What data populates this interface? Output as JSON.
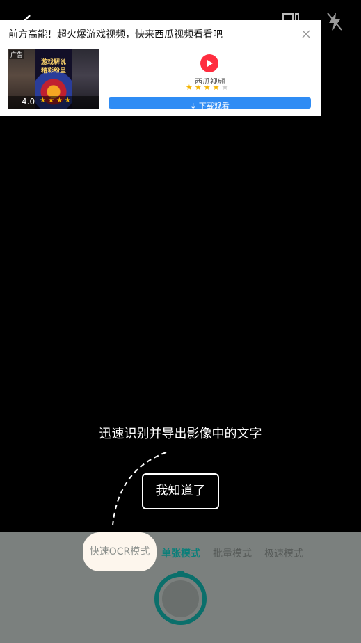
{
  "ad": {
    "title": "前方高能！超火爆游戏视频，快来西瓜视频看看吧",
    "tag": "广告",
    "rating": "4.0",
    "thumb_text": "游戏解说\n精彩纷呈",
    "app_name": "西瓜视频",
    "app_rating_stars": 4,
    "download_label": "下载观看",
    "brand_color": "#ff2d3f",
    "button_color": "#2f8cf4"
  },
  "guide": {
    "hint": "迅速识别并导出影像中的文字",
    "confirm_label": "我知道了"
  },
  "modes": {
    "fast_ocr": "快速OCR模式",
    "single": "单张模式",
    "batch": "批量模式",
    "speed": "极速模式",
    "active": "单张模式"
  },
  "colors": {
    "accent": "#0b7f7a",
    "bottom_bg": "#7b807e"
  }
}
